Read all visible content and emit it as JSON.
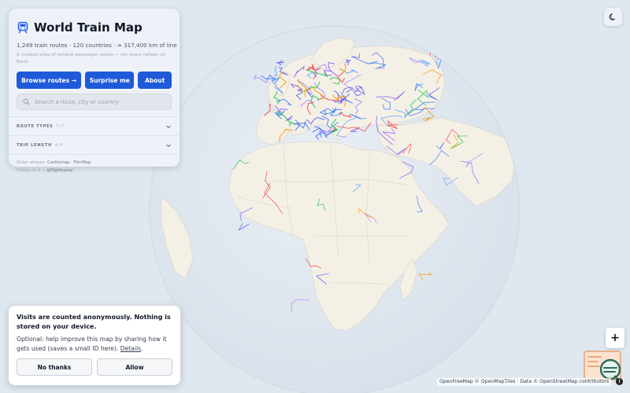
{
  "app": {
    "title": "World Train Map",
    "stats": "1,249 train routes · 120 countries · ≈ 317,400 km of line",
    "description": "A curated atlas of notable passenger routes — not every railway on Earth",
    "icon": "train-icon"
  },
  "actions": {
    "browse": "Browse routes →",
    "surprise": "Surprise me",
    "about": "About"
  },
  "search": {
    "placeholder": "Search a route, city or country",
    "value": ""
  },
  "filters": [
    {
      "label": "ROUTE TYPES",
      "count": "5/7"
    },
    {
      "label": "TRIP LENGTH",
      "count": "4/4"
    }
  ],
  "footer": {
    "sister_prefix": "Sister atlases:",
    "sister_links": "Castlemap · FilmMap",
    "follow_prefix": "Follow on X →",
    "follow_handle": "@flightsassy"
  },
  "consent": {
    "title": "Visits are counted anonymously. Nothing is stored on your device.",
    "body": "Optional: help improve this map by sharing how it gets used (saves a small ID here).",
    "details": "Details",
    "decline": "No thanks",
    "accept": "Allow"
  },
  "map": {
    "attribution": "OpenFreeMap © OpenMapTiles · Data © OpenStreetMap contributors",
    "zoom_in": "+",
    "info": "i",
    "ocean_color": "#dfe7ef",
    "land_color": "#f4f0e6",
    "route_colors": [
      "#3b82f6",
      "#8b5cf6",
      "#a78bfa",
      "#22c55e",
      "#f59e0b",
      "#ef4444",
      "#60a5fa",
      "#6366f1"
    ]
  }
}
